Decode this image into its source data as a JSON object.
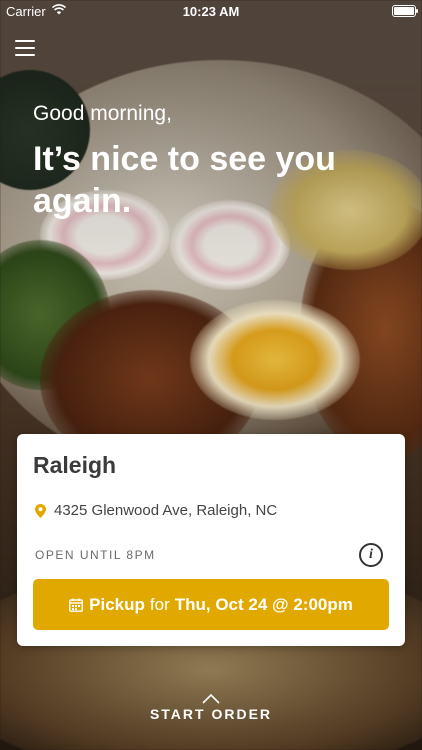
{
  "status_bar": {
    "carrier": "Carrier",
    "time": "10:23 AM",
    "wifi_icon": "wifi-icon",
    "battery_icon": "battery-icon"
  },
  "header": {
    "menu_icon": "hamburger-menu-icon"
  },
  "hero": {
    "greeting": "Good morning,",
    "headline": "It’s nice to see you again."
  },
  "location_card": {
    "city": "Raleigh",
    "address": "4325 Glenwood Ave, Raleigh, NC",
    "pin_icon": "location-pin-icon",
    "hours": "OPEN UNTIL 8PM",
    "info_icon": "info-icon",
    "pickup": {
      "calendar_icon": "calendar-icon",
      "label": "Pickup",
      "connector": "for",
      "datetime": "Thu, Oct 24 @ 2:00pm"
    }
  },
  "footer": {
    "chevron_icon": "chevron-up-icon",
    "start_order": "START ORDER"
  },
  "colors": {
    "accent": "#e1a900",
    "card_bg": "#ffffff",
    "text_dark": "#3b3b3b"
  }
}
